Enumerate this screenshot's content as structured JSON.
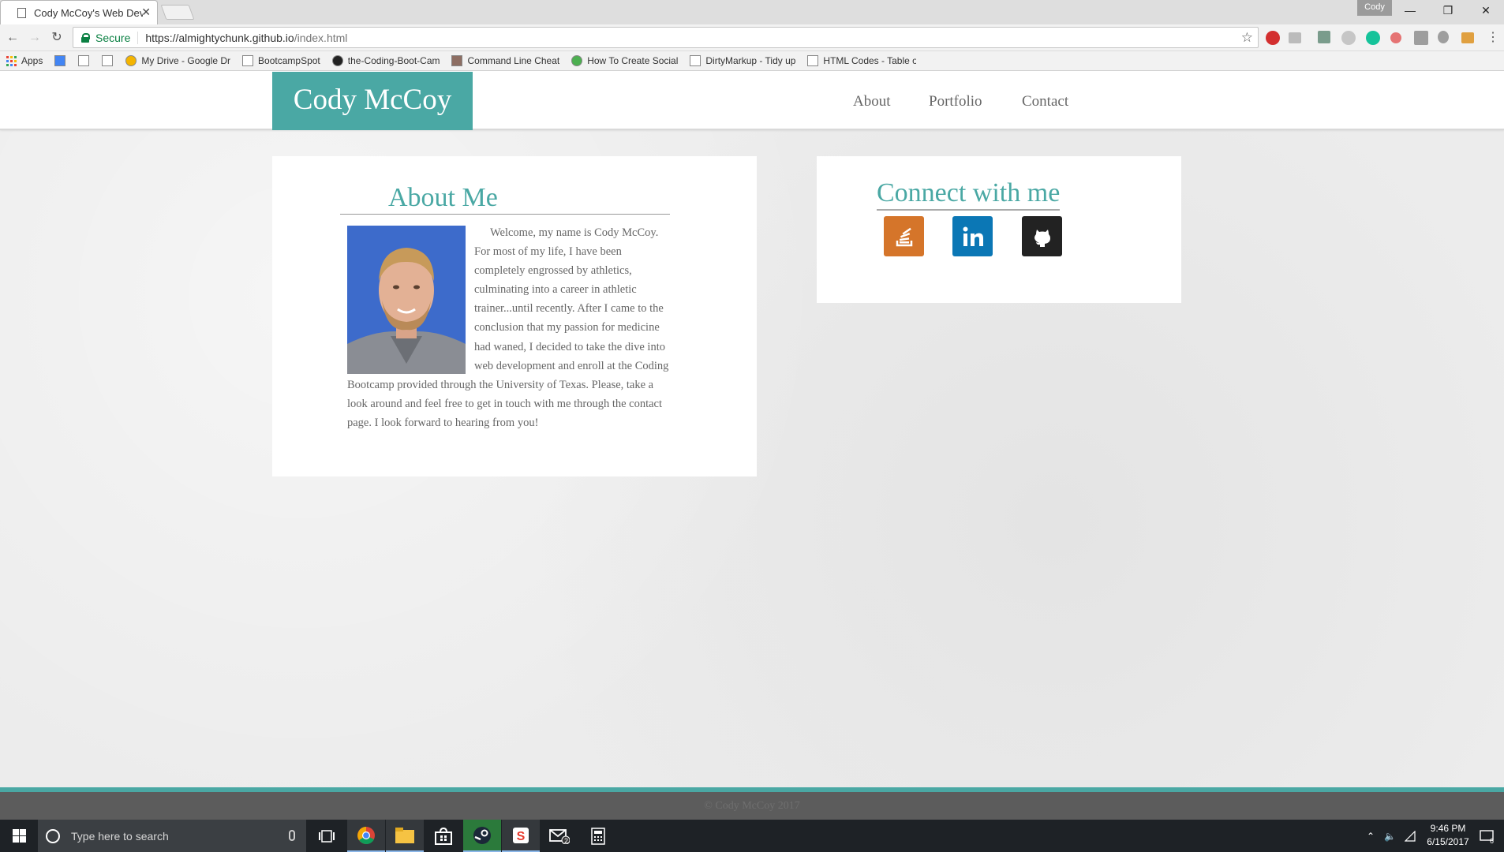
{
  "browser": {
    "tab_title": "Cody McCoy's Web Deve",
    "tab_close": "✕",
    "profile_name": "Cody",
    "secure_label": "Secure",
    "url_host": "https://almightychunk.github.io",
    "url_path": "/index.html",
    "bookmarks": [
      {
        "label": "Apps",
        "icon": "apps-grid-icon"
      },
      {
        "label": "",
        "icon": "calendar-icon"
      },
      {
        "label": "",
        "icon": "google-icon"
      },
      {
        "label": "",
        "icon": "book-icon"
      },
      {
        "label": "My Drive - Google Dr",
        "icon": "drive-icon"
      },
      {
        "label": "BootcampSpot",
        "icon": "page-icon"
      },
      {
        "label": "the-Coding-Boot-Cam",
        "icon": "github-icon"
      },
      {
        "label": "Command Line Cheat",
        "icon": "trophy-icon"
      },
      {
        "label": "How To Create Social",
        "icon": "w3-icon"
      },
      {
        "label": "DirtyMarkup - Tidy up",
        "icon": "code-icon"
      },
      {
        "label": "HTML Codes - Table o",
        "icon": "page-icon"
      }
    ]
  },
  "site": {
    "brand": "Cody McCoy",
    "nav": [
      "About",
      "Portfolio",
      "Contact"
    ],
    "about_title": "About Me",
    "about_text": "Welcome, my name is Cody McCoy. For most of my life, I have been completely engrossed by athletics, culminating into a career in athletic trainer...until recently. After I came to the conclusion that my passion for medicine had waned, I decided to take the dive into web development and enroll at the Coding Bootcamp provided through the University of Texas. Please, take a look around and feel free to get in touch with me through the contact page. I look forward to hearing from you!",
    "connect_title": "Connect with me",
    "social": [
      {
        "name": "stackoverflow",
        "icon": "stack-overflow-icon",
        "color": "#d5752a"
      },
      {
        "name": "linkedin",
        "icon": "linkedin-icon",
        "color": "#0b77b5"
      },
      {
        "name": "github",
        "icon": "github-icon",
        "color": "#222222"
      }
    ],
    "footer": "© Cody McCoy 2017",
    "accent_color": "#4aa8a4"
  },
  "taskbar": {
    "search_placeholder": "Type here to search",
    "time": "9:46 PM",
    "date": "6/15/2017",
    "mail_badge": "2",
    "notification_count": "6"
  }
}
